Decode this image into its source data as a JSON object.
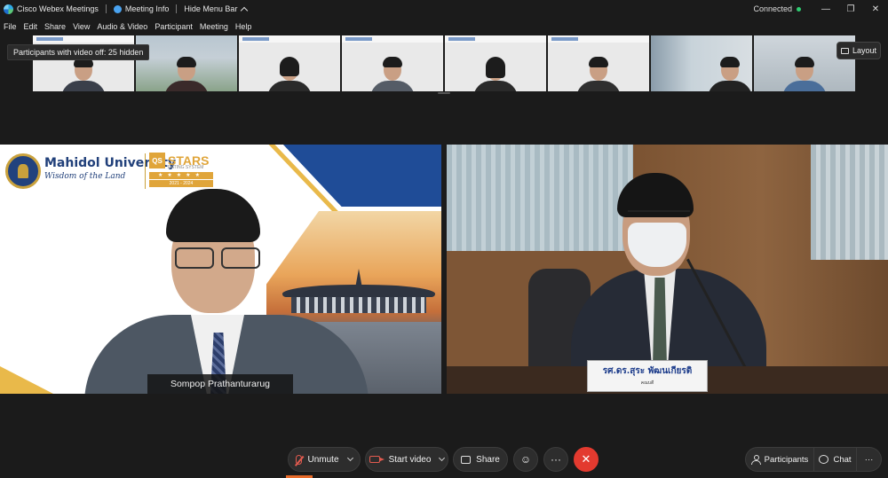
{
  "titlebar": {
    "app_name": "Cisco Webex Meetings",
    "meeting_info": "Meeting Info",
    "hide_menu_bar": "Hide Menu Bar",
    "status": "Connected",
    "status_color": "#2ecc71"
  },
  "menu": [
    "File",
    "Edit",
    "Share",
    "View",
    "Audio & Video",
    "Participant",
    "Meeting",
    "Help"
  ],
  "tooltip": "Participants with video off: 25 hidden",
  "layout_button": "Layout",
  "slide": {
    "university": "Mahidol University",
    "tagline": "Wisdom of the Land",
    "stars_qs": "QS",
    "stars_word": "STARS",
    "stars_small": "RATING SYSTEM",
    "stars_rating": "★★★★★",
    "stars_years": "2021 - 2024"
  },
  "presenter_name": "Sompop Prathanturarug",
  "nameplate": {
    "line1": "รศ.ดร.สุระ พัฒนเกียรติ",
    "line2": "คณบดี"
  },
  "controls": {
    "unmute": "Unmute",
    "start_video": "Start video",
    "share": "Share",
    "participants": "Participants",
    "chat": "Chat",
    "more": "···",
    "leave_color": "#e33a2f"
  }
}
